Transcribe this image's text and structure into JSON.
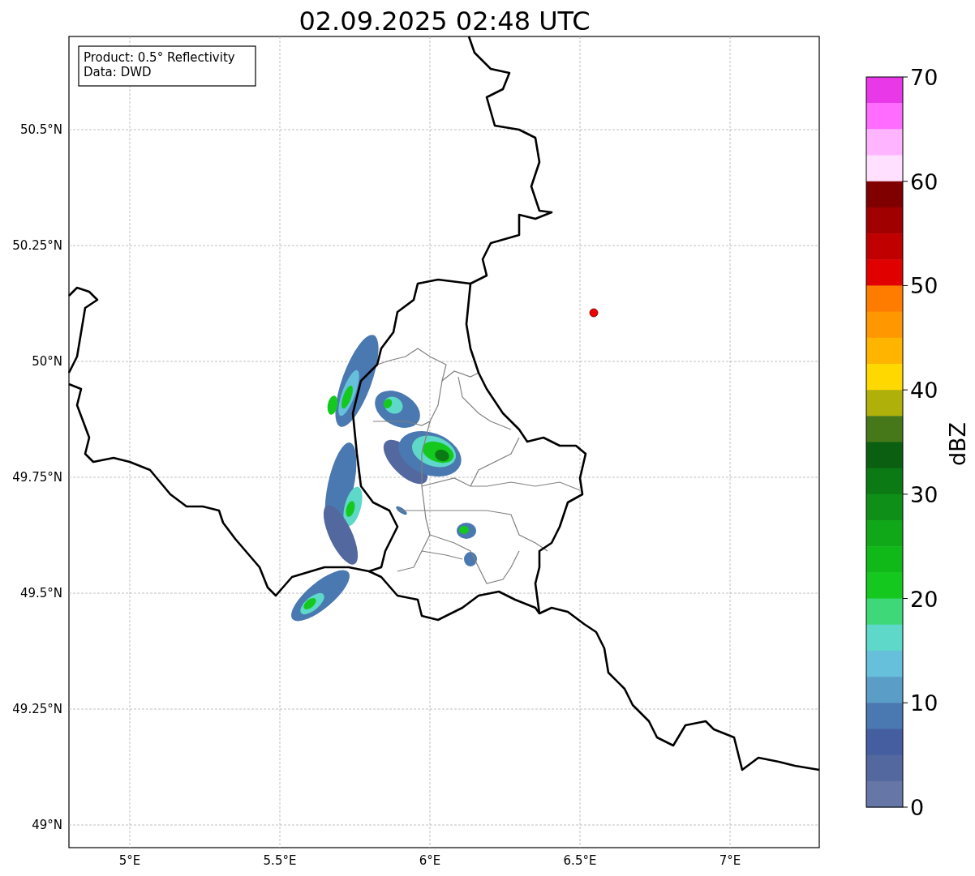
{
  "title": "02.09.2025 02:48 UTC",
  "info_box": {
    "lines": [
      "Product: 0.5° Reflectivity",
      "Data: DWD"
    ]
  },
  "map": {
    "lat_labels": [
      "50.5°N",
      "50.25°N",
      "50°N",
      "49.75°N",
      "49.5°N",
      "49.25°N",
      "49°N"
    ],
    "lon_labels": [
      "5°E",
      "5.5°E",
      "6°E",
      "6.5°E",
      "7°E"
    ]
  },
  "colorbar": {
    "label": "dBZ",
    "ticks": [
      "70",
      "60",
      "50",
      "40",
      "30",
      "20",
      "10",
      "0"
    ],
    "segments": [
      {
        "color": "#e838e8"
      },
      {
        "color": "#ff6cff"
      },
      {
        "color": "#ffb4ff"
      },
      {
        "color": "#ffe0ff"
      },
      {
        "color": "#800000"
      },
      {
        "color": "#a00000"
      },
      {
        "color": "#c00000"
      },
      {
        "color": "#e00000"
      },
      {
        "color": "#ff7c00"
      },
      {
        "color": "#ff9800"
      },
      {
        "color": "#ffb400"
      },
      {
        "color": "#ffd800"
      },
      {
        "color": "#b0b00a"
      },
      {
        "color": "#46781a"
      },
      {
        "color": "#0a6010"
      },
      {
        "color": "#0c7a14"
      },
      {
        "color": "#0e9018"
      },
      {
        "color": "#10a818"
      },
      {
        "color": "#10b818"
      },
      {
        "color": "#14c81e"
      },
      {
        "color": "#3ed878"
      },
      {
        "color": "#5ed8c8"
      },
      {
        "color": "#66c0dc"
      },
      {
        "color": "#5a9ec8"
      },
      {
        "color": "#4a78b0"
      },
      {
        "color": "#445ea0"
      },
      {
        "color": "#5468a0"
      },
      {
        "color": "#6676a6"
      }
    ]
  }
}
